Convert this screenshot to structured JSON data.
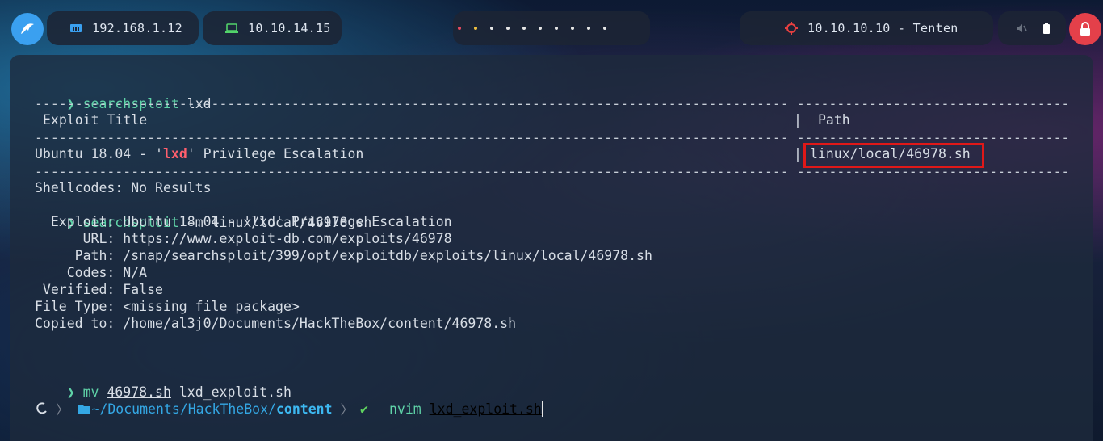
{
  "topbar": {
    "ip_local": "192.168.1.12",
    "ip_vpn": "10.10.14.15",
    "target": "10.10.10.10 - Tenten"
  },
  "terminal": {
    "cmd1": "searchsploit",
    "cmd1_arg": "lxd",
    "dashes_left": "----------------------------------------------------------------------------------------------",
    "dashes_right": "----------------------------------",
    "col_title": "Exploit Title",
    "col_sep": "|",
    "col_path": "Path",
    "row_pre": "Ubuntu 18.04 - '",
    "row_hl": "lxd",
    "row_post": "' Privilege Escalation",
    "row_path": "linux/local/46978.sh",
    "shellcodes": "Shellcodes: No Results",
    "cmd2": "searchsploit",
    "cmd2_arg": "-m linux/local/46978.sh",
    "info": [
      "  Exploit: Ubuntu 18.04 - 'lxd' Privilege Escalation",
      "      URL: https://www.exploit-db.com/exploits/46978",
      "     Path: /snap/searchsploit/399/opt/exploitdb/exploits/linux/local/46978.sh",
      "    Codes: N/A",
      " Verified: False",
      "File Type: <missing file package>",
      "Copied to: /home/al3j0/Documents/HackTheBox/content/46978.sh"
    ],
    "cmd3": "mv",
    "cmd3_arg1": "46978.sh",
    "cmd3_arg2": "lxd_exploit.sh",
    "prompt_dir_prefix": "~/Documents/HackTheBox/",
    "prompt_dir_last": "content",
    "prompt_check": "✔",
    "cmd4": "nvim",
    "cmd4_arg": "lxd_exploit.sh",
    "prompt_symbol": "❯"
  }
}
